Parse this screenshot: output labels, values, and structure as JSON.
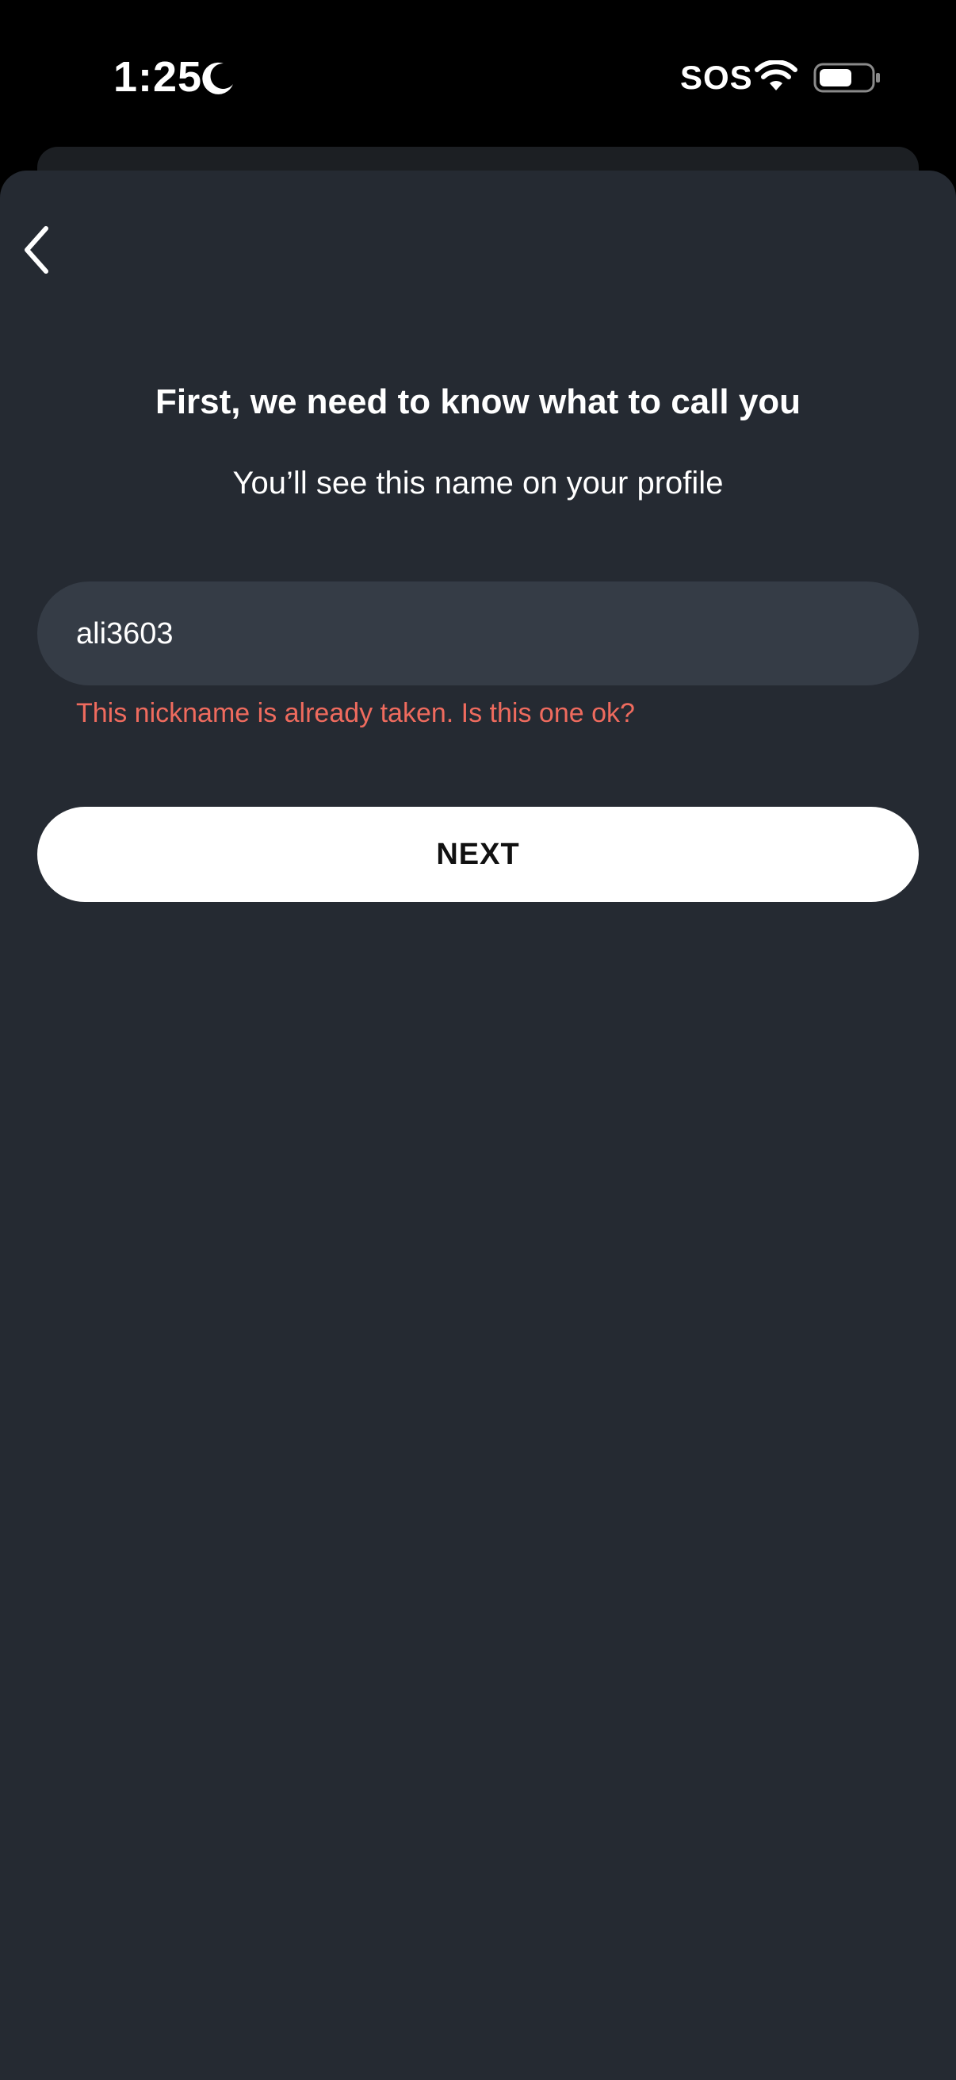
{
  "status_bar": {
    "time": "1:25",
    "carrier": "SOS",
    "icons": [
      "moon-icon",
      "wifi-icon",
      "battery-icon"
    ]
  },
  "header": {
    "back_icon": "chevron-left-icon"
  },
  "main": {
    "title": "First, we need to know what to call you",
    "subtitle": "You’ll see this name on your profile",
    "nickname_value": "ali3603",
    "error_message": "This nickname is already taken. Is this one ok?",
    "next_label": "NEXT"
  },
  "colors": {
    "background": "#252a32",
    "input_background": "#353c46",
    "error": "#ef6b5e",
    "button": "#ffffff"
  }
}
